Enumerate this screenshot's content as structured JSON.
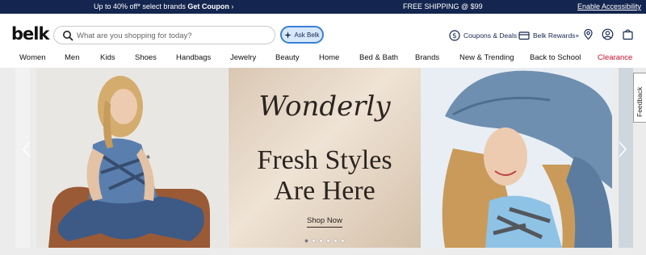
{
  "promo_bar": {
    "left_prefix": "Up to 40% off* select brands ",
    "left_cta": "Get Coupon",
    "left_chevron": "›",
    "center": "FREE SHIPPING @ $99",
    "right": "Enable Accessibility"
  },
  "header": {
    "logo": "belk",
    "search_placeholder": "What are you shopping for today?",
    "ask_label": "Ask Belk",
    "coupons_label": "Coupons & Deals",
    "rewards_label": "Belk Rewards+"
  },
  "nav": {
    "items": [
      "Women",
      "Men",
      "Kids",
      "Shoes",
      "Handbags",
      "Jewelry",
      "Beauty",
      "Home",
      "Bed & Bath",
      "Brands",
      "New & Trending",
      "Back to School",
      "Clearance"
    ]
  },
  "hero": {
    "script_title": "Wonderly",
    "headline_line1": "Fresh Styles",
    "headline_line2": "Are Here",
    "cta": "Shop Now",
    "slide_count": 6,
    "active_slide": 1
  },
  "feedback": {
    "label": "Feedback"
  },
  "colors": {
    "navy": "#14264f",
    "clearance_red": "#c8102e",
    "ask_border": "#3a7fd6",
    "ask_bg": "#d7e8fb"
  },
  "icons": [
    "search-icon",
    "sparkle-icon",
    "coupon-icon",
    "card-icon",
    "location-icon",
    "account-icon",
    "bag-icon",
    "chevron-left-icon",
    "chevron-right-icon"
  ]
}
